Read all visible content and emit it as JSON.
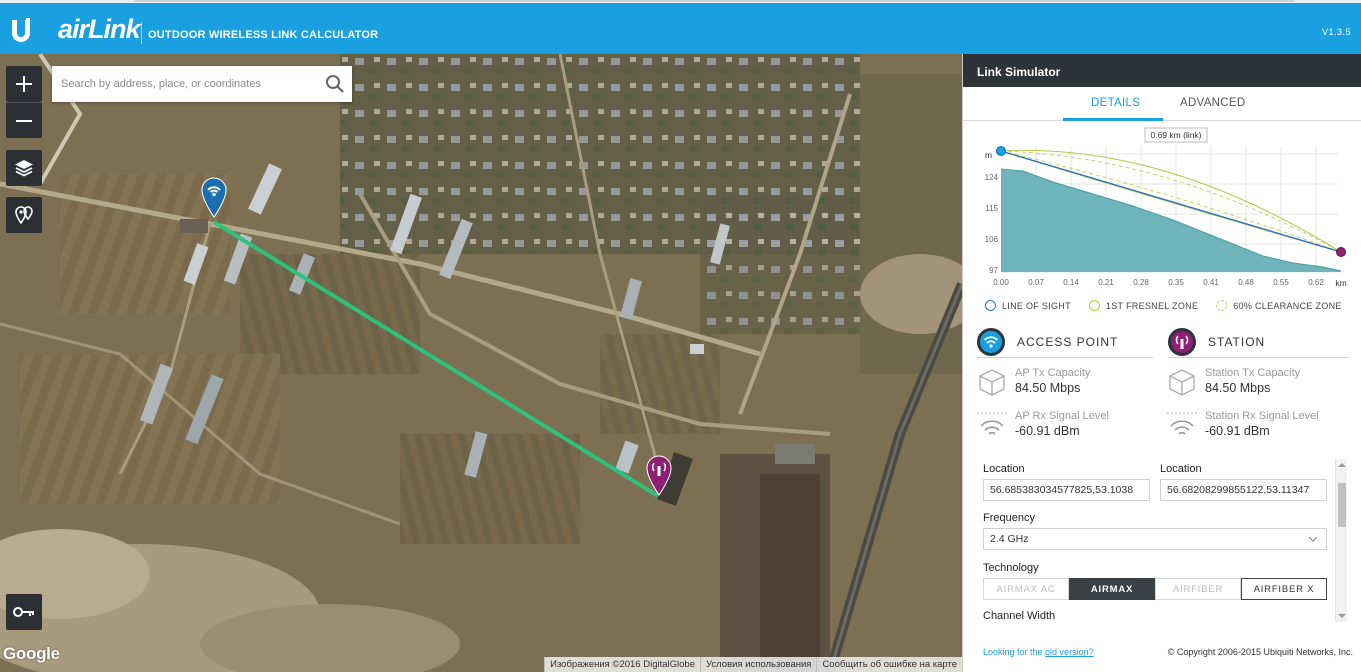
{
  "header": {
    "brand": "airLink",
    "subtitle": "OUTDOOR WIRELESS LINK CALCULATOR",
    "version": "V1.3.5"
  },
  "map": {
    "search_placeholder": "Search by address, place, or coordinates",
    "zoom_in": "+",
    "zoom_out": "−",
    "google": "Google",
    "footer": [
      "Изображения ©2016 DigitalGlobe",
      "Условия использования",
      "Сообщить об ошибке на карте"
    ],
    "ap_marker_color": "#1a6fb0",
    "station_marker_color": "#8e1f74",
    "link_color": "#2ec27e"
  },
  "panel": {
    "title": "Link Simulator",
    "tabs": [
      {
        "label": "DETAILS",
        "active": true
      },
      {
        "label": "ADVANCED",
        "active": false
      }
    ],
    "profile": {
      "link_label": "0.69 km (link)",
      "y_unit": "m",
      "x_unit": "km",
      "y_ticks": [
        "124",
        "115",
        "106",
        "97"
      ],
      "x_ticks": [
        "0.00",
        "0.07",
        "0.14",
        "0.21",
        "0.28",
        "0.35",
        "0.41",
        "0.48",
        "0.55",
        "0.62"
      ]
    },
    "legend": [
      "LINE OF SIGHT",
      "1ST FRESNEL ZONE",
      "60% CLEARANCE ZONE"
    ],
    "access_point": {
      "title": "ACCESS POINT",
      "tx_label": "AP Tx Capacity",
      "tx_value": "84.50 Mbps",
      "rx_label": "AP Rx Signal Level",
      "rx_value": "-60.91 dBm"
    },
    "station": {
      "title": "STATION",
      "tx_label": "Station Tx Capacity",
      "tx_value": "84.50 Mbps",
      "rx_label": "Station Rx Signal Level",
      "rx_value": "-60.91 dBm"
    },
    "form": {
      "location_label": "Location",
      "ap_location": "56.685383034577825,53.1038",
      "station_location": "56.68208299855122,53.11347",
      "frequency_label": "Frequency",
      "frequency_value": "2.4 GHz",
      "technology_label": "Technology",
      "technologies": [
        "AIRMAX AC",
        "AIRMAX",
        "AIRFIBER",
        "AIRFIBER X"
      ],
      "selected_technology": "AIRMAX",
      "channel_width_label": "Channel Width"
    },
    "footer": {
      "prefix": "Looking for the ",
      "link": "old version?",
      "copyright": "© Copyright 2006-2015 Ubiquiti Networks, Inc."
    },
    "accent": "#1a9fe0"
  }
}
